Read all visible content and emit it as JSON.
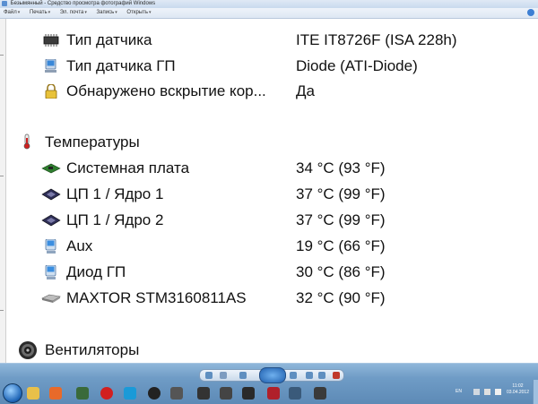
{
  "window": {
    "title": "Безымянный - Средство просмотра фотографий Windows"
  },
  "menu": [
    {
      "label": "Файл"
    },
    {
      "label": "Печать"
    },
    {
      "label": "Эл. почта"
    },
    {
      "label": "Запись"
    },
    {
      "label": "Открыть"
    }
  ],
  "sensor_rows": [
    {
      "label": "Тип датчика",
      "value": "ITE IT8726F  (ISA 228h)",
      "icon": "chip-icon"
    },
    {
      "label": "Тип датчика ГП",
      "value": "Diode  (ATI-Diode)",
      "icon": "monitor-icon"
    },
    {
      "label": "Обнаружено вскрытие кор...",
      "value": "Да",
      "icon": "lock-icon"
    }
  ],
  "temperatures": {
    "heading": "Температуры",
    "icon": "thermometer-icon",
    "items": [
      {
        "label": "Системная плата",
        "value": "34 °C  (93 °F)",
        "icon": "motherboard-icon"
      },
      {
        "label": "ЦП 1 / Ядро 1",
        "value": "37 °C  (99 °F)",
        "icon": "cpu-icon"
      },
      {
        "label": "ЦП 1 / Ядро 2",
        "value": "37 °C  (99 °F)",
        "icon": "cpu-icon"
      },
      {
        "label": "Aux",
        "value": "19 °C  (66 °F)",
        "icon": "computer-icon"
      },
      {
        "label": "Диод ГП",
        "value": "30 °C  (86 °F)",
        "icon": "computer-icon"
      },
      {
        "label": "MAXTOR STM3160811AS",
        "value": "32 °C  (90 °F)",
        "icon": "harddisk-icon"
      }
    ]
  },
  "fans": {
    "heading": "Вентиляторы",
    "icon": "fan-icon"
  },
  "taskbar": {
    "lang": "EN",
    "time": "11:02",
    "date": "03.04.2012"
  }
}
